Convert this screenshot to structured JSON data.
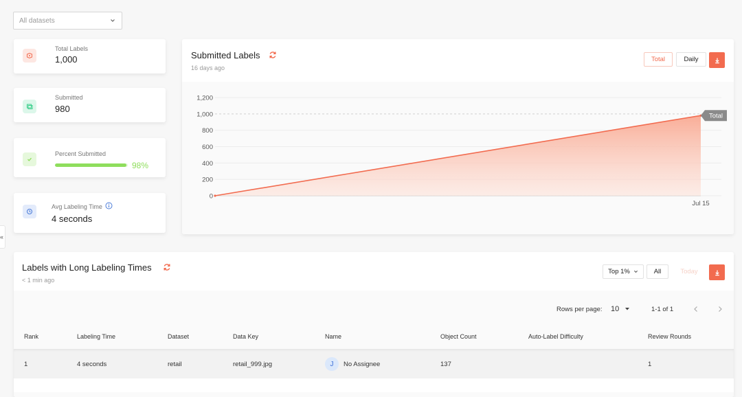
{
  "filters": {
    "dataset_placeholder": "All datasets"
  },
  "stats": [
    {
      "label": "Total Labels",
      "value": "1,000",
      "icon": "tag-icon",
      "color": "#f26b4f"
    },
    {
      "label": "Submitted",
      "value": "980",
      "icon": "layers-icon",
      "color": "#3ecf8e"
    },
    {
      "label": "Percent Submitted",
      "percent": 98,
      "percent_text": "98%",
      "icon": "check-icon",
      "color": "#8fde5d"
    },
    {
      "label": "Avg Labeling Time",
      "value": "4 seconds",
      "icon": "clock-icon",
      "color": "#4a7bd8"
    }
  ],
  "submitted_chart": {
    "title": "Submitted Labels",
    "updated": "16 days ago",
    "buttons": {
      "total": "Total",
      "daily": "Daily"
    },
    "accent": "#f26b4f"
  },
  "chart_data": {
    "type": "area",
    "x": [
      "",
      "Jul 15"
    ],
    "series": [
      {
        "name": "Total",
        "values": [
          0,
          980
        ]
      }
    ],
    "yticks": [
      "0",
      "200",
      "400",
      "600",
      "800",
      "1,000",
      "1,200"
    ],
    "ylim": [
      0,
      1200
    ],
    "reference_value": 1000,
    "grid": true
  },
  "long_times": {
    "title": "Labels with Long Labeling Times",
    "updated": "< 1 min ago",
    "buttons": {
      "top": "Top 1%",
      "all": "All",
      "today": "Today"
    },
    "pager": {
      "rows_label": "Rows per page:",
      "rows_value": "10",
      "range": "1-1 of 1"
    },
    "columns": [
      "Rank",
      "Labeling Time",
      "Dataset",
      "Data Key",
      "Name",
      "Object Count",
      "Auto-Label Difficulty",
      "Review Rounds"
    ],
    "rows": [
      {
        "rank": "1",
        "time": "4 seconds",
        "dataset": "retail",
        "data_key": "retail_999.jpg",
        "avatar": "J",
        "name": "No Assignee",
        "object_count": "137",
        "difficulty": "",
        "review_rounds": "1"
      }
    ]
  },
  "sidebar": {
    "collapse_glyph": "«"
  }
}
